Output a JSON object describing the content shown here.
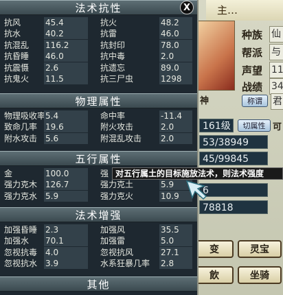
{
  "background": {
    "title": "主…",
    "labels": [
      "种族",
      "帮派",
      "声望",
      "战绩"
    ],
    "label_values": [
      "仙",
      "与",
      "11",
      "34"
    ],
    "title_button": "称谓",
    "title_value": "君",
    "god_label": "神",
    "level": "161级",
    "switch_button": "切属性",
    "extra_char": "可",
    "fields": [
      "53/38949",
      "45/99845",
      "6",
      "78818"
    ],
    "bottom_buttons": [
      "变",
      "灵宝",
      "飲",
      "坐骑"
    ]
  },
  "panel": {
    "close_label": "X",
    "sections": [
      {
        "title": "法术抗性",
        "rows": [
          [
            "抗风",
            "45.4",
            "抗火",
            "48.2"
          ],
          [
            "抗水",
            "40.2",
            "抗雷",
            "46.0"
          ],
          [
            "抗混乱",
            "116.2",
            "抗封印",
            "78.0"
          ],
          [
            "抗昏睡",
            "46.0",
            "抗中毒",
            "2.0"
          ],
          [
            "抗震慑",
            "2.6",
            "抗遗忘",
            "89.0"
          ],
          [
            "抗鬼火",
            "11.5",
            "抗三尸虫",
            "1298"
          ]
        ]
      },
      {
        "title": "物理属性",
        "rows": [
          [
            "物理吸收率",
            "5.4",
            "命中率",
            "-11.4"
          ],
          [
            "致命几率",
            "19.6",
            "附火攻击",
            "2.0"
          ],
          [
            "附水攻击",
            "5.6",
            "附混乱攻击",
            "2.0"
          ]
        ]
      },
      {
        "title": "五行属性",
        "rows": [
          [
            "金",
            "100.0",
            "强",
            ""
          ],
          [
            "强力克木",
            "126.7",
            "强力克土",
            "5.9"
          ],
          [
            "强力克水",
            "5.9",
            "强力克火",
            "10.9"
          ]
        ]
      },
      {
        "title": "法术增强",
        "rows": [
          [
            "加强昏睡",
            "2.3",
            "加强风",
            "35.5"
          ],
          [
            "加强水",
            "70.1",
            "加强雷",
            "5.0"
          ],
          [
            "忽视抗毒",
            "4.0",
            "忽视抗风",
            "27.1"
          ],
          [
            "忽视抗水",
            "3.9",
            "水系狂暴几率",
            "2.8"
          ]
        ]
      },
      {
        "title": "其他",
        "rows": []
      }
    ]
  },
  "tooltip": {
    "text": "对五行属土的目标施放法术，则法术强度"
  }
}
